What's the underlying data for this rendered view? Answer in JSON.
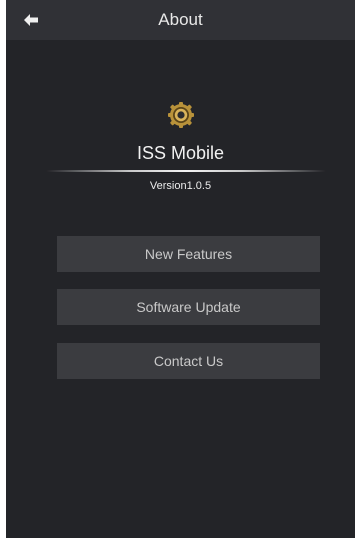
{
  "header": {
    "title": "About",
    "back_icon": "back-arrow-icon"
  },
  "app": {
    "icon": "gear-logo-icon",
    "name": "ISS Mobile",
    "version": "Version1.0.5"
  },
  "menu": {
    "items": [
      {
        "label": "New Features"
      },
      {
        "label": "Software Update"
      },
      {
        "label": "Contact Us"
      }
    ]
  },
  "colors": {
    "background": "#232428",
    "header_bg": "#303136",
    "button_bg": "#3b3c40",
    "button_text": "#c9c9c9",
    "logo_gold": "#b8923a"
  }
}
